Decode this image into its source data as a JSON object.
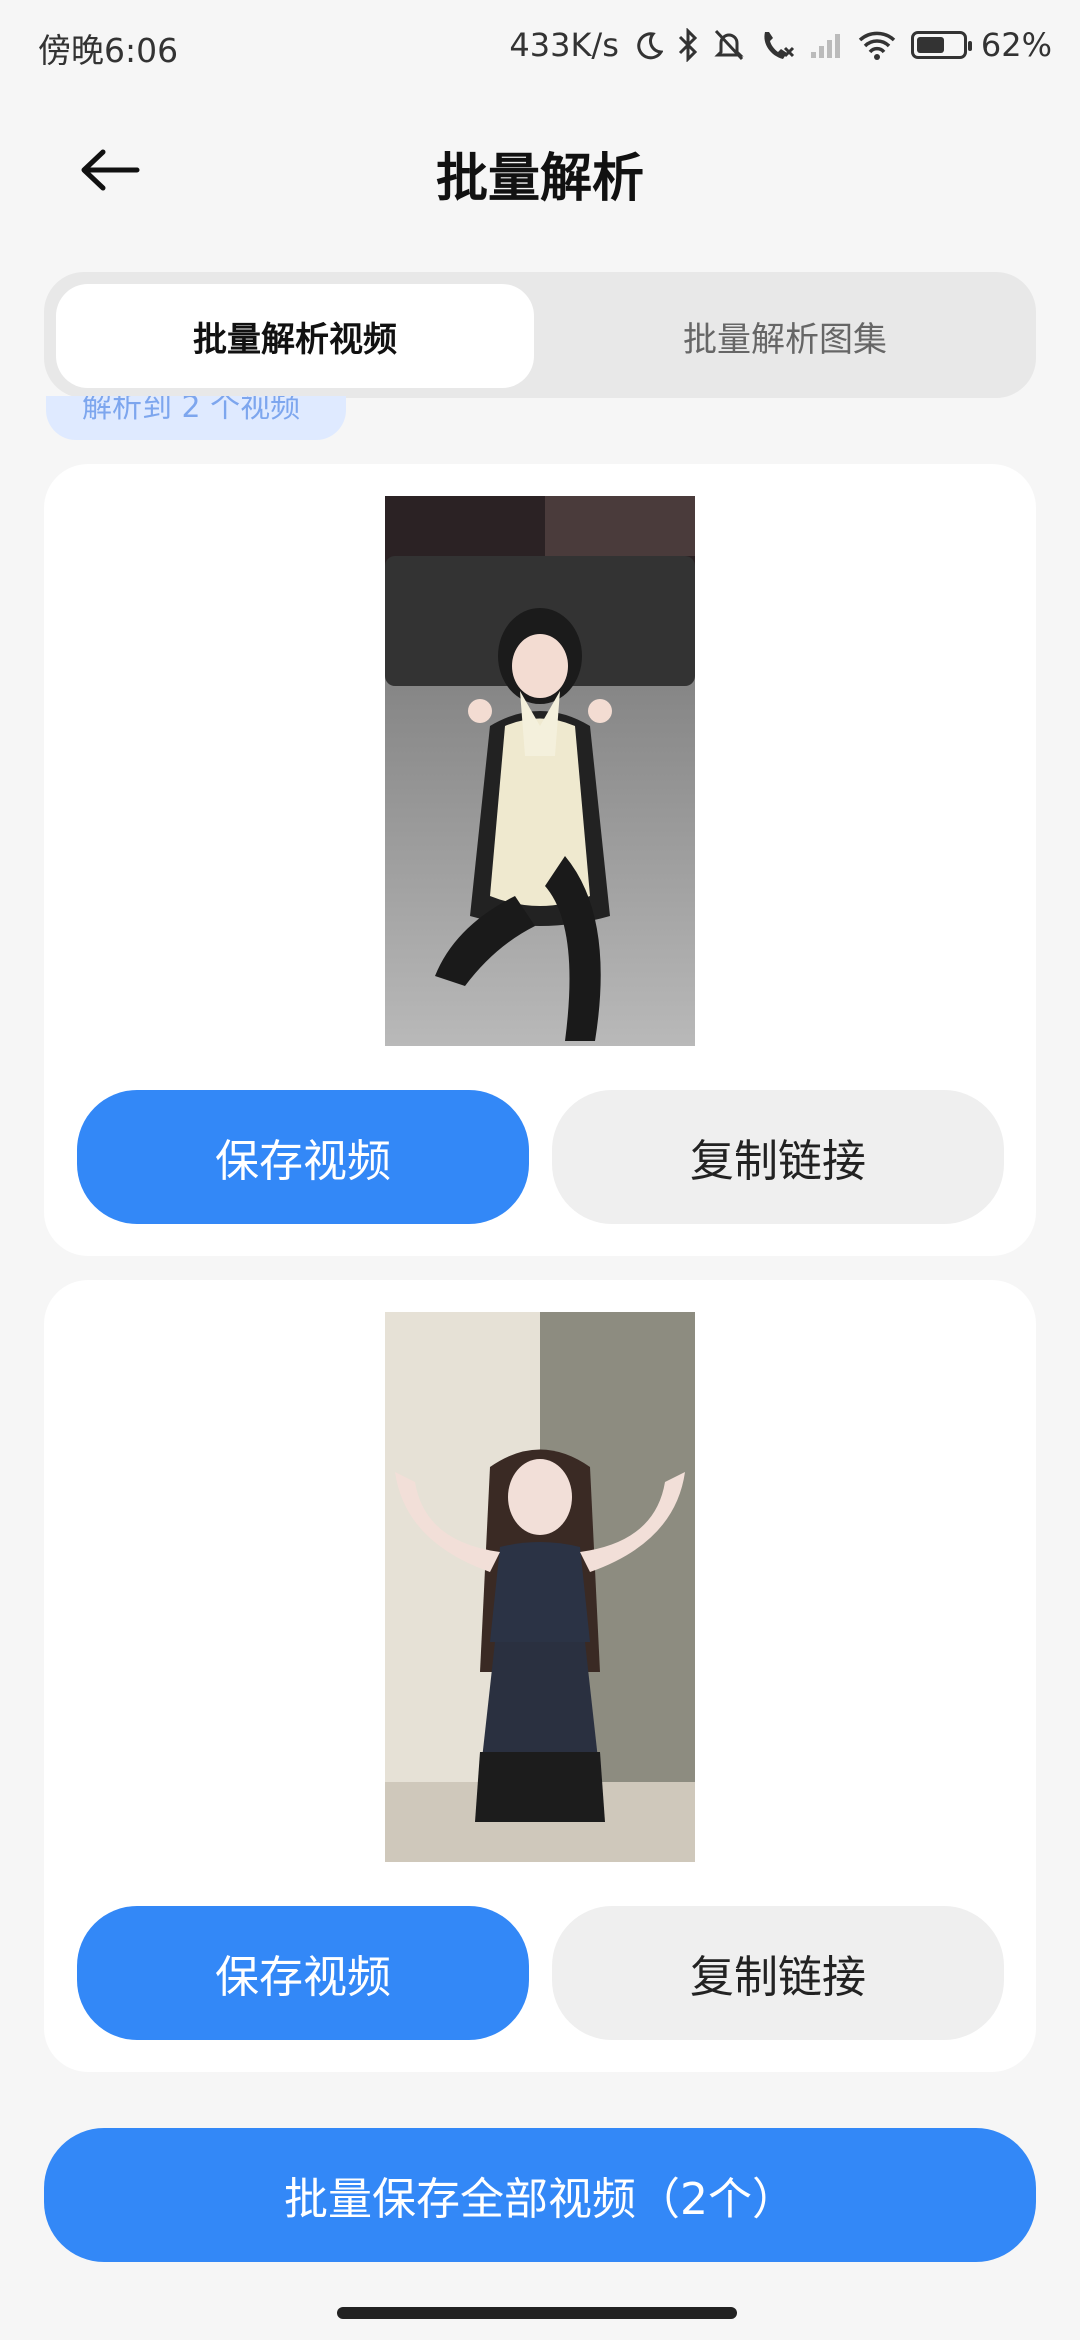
{
  "status_bar": {
    "time": "傍晚6:06",
    "net_speed": "433K/s",
    "battery": "62%",
    "battery_level": 0.62,
    "icons": [
      "moon-icon",
      "bluetooth-icon",
      "mute-bell-icon",
      "missed-call-icon",
      "signal-icon",
      "wifi-icon",
      "battery-icon"
    ]
  },
  "header": {
    "title": "批量解析",
    "back_icon": "back-arrow-icon"
  },
  "tabs": [
    {
      "label": "批量解析视频",
      "active": true
    },
    {
      "label": "批量解析图集",
      "active": false
    }
  ],
  "chip": {
    "label": "解析到 2 个视频"
  },
  "videos": [
    {
      "save_label": "保存视频",
      "copy_label": "复制链接"
    },
    {
      "save_label": "保存视频",
      "copy_label": "复制链接"
    }
  ],
  "bulk_save": {
    "label": "批量保存全部视频（2个）"
  },
  "colors": {
    "primary": "#3388f7",
    "background": "#f6f6f6",
    "card": "#ffffff",
    "tab_track": "#e8e8e8"
  }
}
